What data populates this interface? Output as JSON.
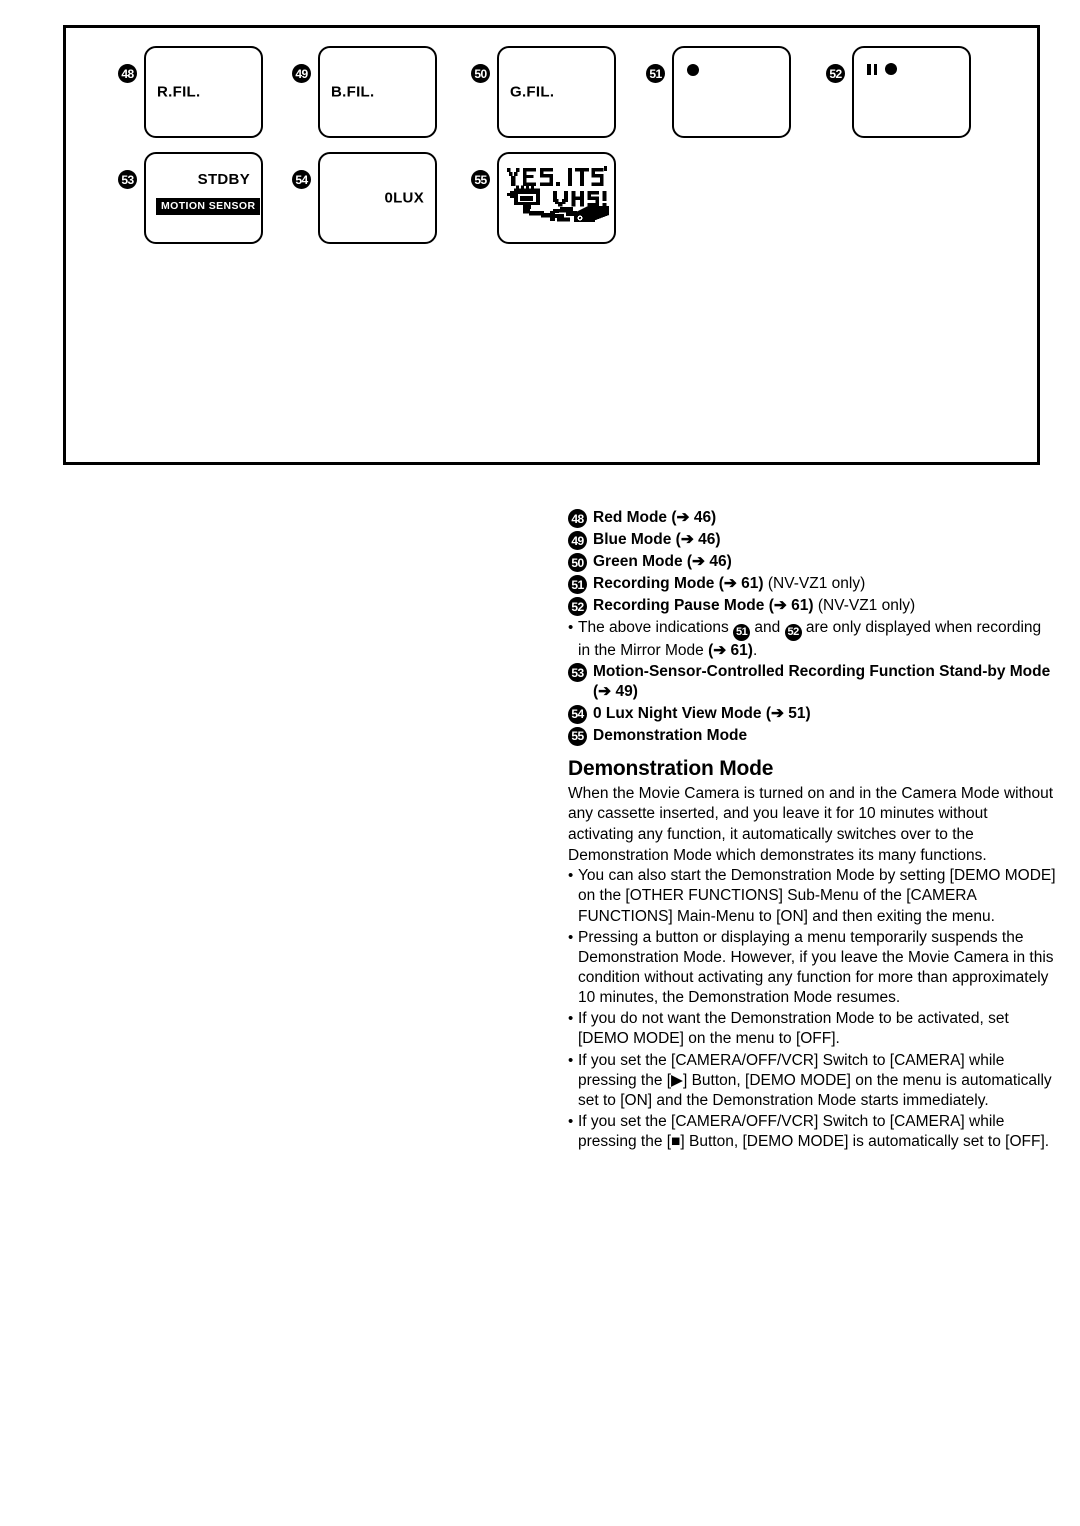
{
  "figure": {
    "panels": [
      {
        "num": "48",
        "label": "R.FIL.",
        "label_pos": "left-mid",
        "icon": "none"
      },
      {
        "num": "49",
        "label": "B.FIL.",
        "label_pos": "left-mid",
        "icon": "none"
      },
      {
        "num": "50",
        "label": "G.FIL.",
        "label_pos": "left-mid",
        "icon": "none"
      },
      {
        "num": "51",
        "label": "",
        "label_pos": "none",
        "icon": "record-dot-icon"
      },
      {
        "num": "52",
        "label": "",
        "label_pos": "none",
        "icon": "pause-record-icon"
      },
      {
        "num": "53",
        "label": "STDBY",
        "label_pos": "right-upper",
        "icon": "motion-sensor-badge",
        "badge": "MOTION SENSOR"
      },
      {
        "num": "54",
        "label": "0LUX",
        "label_pos": "right-mid",
        "icon": "none"
      },
      {
        "num": "55",
        "label": "",
        "label_pos": "none",
        "icon": "yes-its-vhs-logo",
        "logo_text": "YES, IT'S VHS!"
      }
    ]
  },
  "legend": {
    "items": [
      {
        "num": "48",
        "bold": "Red Mode (➔ 46)",
        "regular": ""
      },
      {
        "num": "49",
        "bold": "Blue Mode (➔ 46)",
        "regular": ""
      },
      {
        "num": "50",
        "bold": "Green Mode (➔ 46)",
        "regular": ""
      },
      {
        "num": "51",
        "bold": "Recording Mode (➔ 61)",
        "regular": " (NV-VZ1 only)"
      },
      {
        "num": "52",
        "bold": "Recording Pause Mode (➔ 61)",
        "regular": " (NV-VZ1 only)"
      }
    ],
    "note_pre": "The above indications ",
    "note_num_a": "51",
    "note_mid": " and ",
    "note_num_b": "52",
    "note_post": " are only displayed when recording in the Mirror Mode ",
    "note_ref": "(➔ 61)",
    "note_end": ".",
    "items_after": [
      {
        "num": "53",
        "bold": "Motion-Sensor-Controlled Recording Function Stand-by Mode (➔ 49)",
        "regular": ""
      },
      {
        "num": "54",
        "bold": "0 Lux Night View Mode (➔ 51)",
        "regular": ""
      },
      {
        "num": "55",
        "bold": "Demonstration Mode",
        "regular": ""
      }
    ]
  },
  "section": {
    "title": "Demonstration Mode",
    "intro": "When the Movie Camera is turned on and in the Camera Mode without any cassette inserted, and you leave it for 10 minutes without activating any function, it automatically switches over to the Demonstration Mode which demonstrates its many functions.",
    "bullets": [
      "You can also start the Demonstration Mode by setting [DEMO MODE] on the [OTHER FUNCTIONS] Sub-Menu of the [CAMERA FUNCTIONS] Main-Menu to [ON] and then exiting the menu.",
      "Pressing a button or displaying a menu temporarily suspends the Demonstration Mode. However, if you leave the Movie Camera in this condition without activating any function for more than approximately 10 minutes, the Demonstration Mode resumes.",
      "If you do not want the Demonstration Mode to be activated, set [DEMO MODE] on the menu to [OFF].",
      "If you set the [CAMERA/OFF/VCR] Switch to [CAMERA] while pressing the [▶] Button, [DEMO MODE] on the menu is automatically set to [ON] and the Demonstration Mode starts immediately.",
      "If you set the [CAMERA/OFF/VCR] Switch to [CAMERA] while pressing the [■] Button, [DEMO MODE] is automatically set to [OFF]."
    ]
  },
  "colors": {
    "ink": "#000000",
    "page": "#ffffff"
  }
}
